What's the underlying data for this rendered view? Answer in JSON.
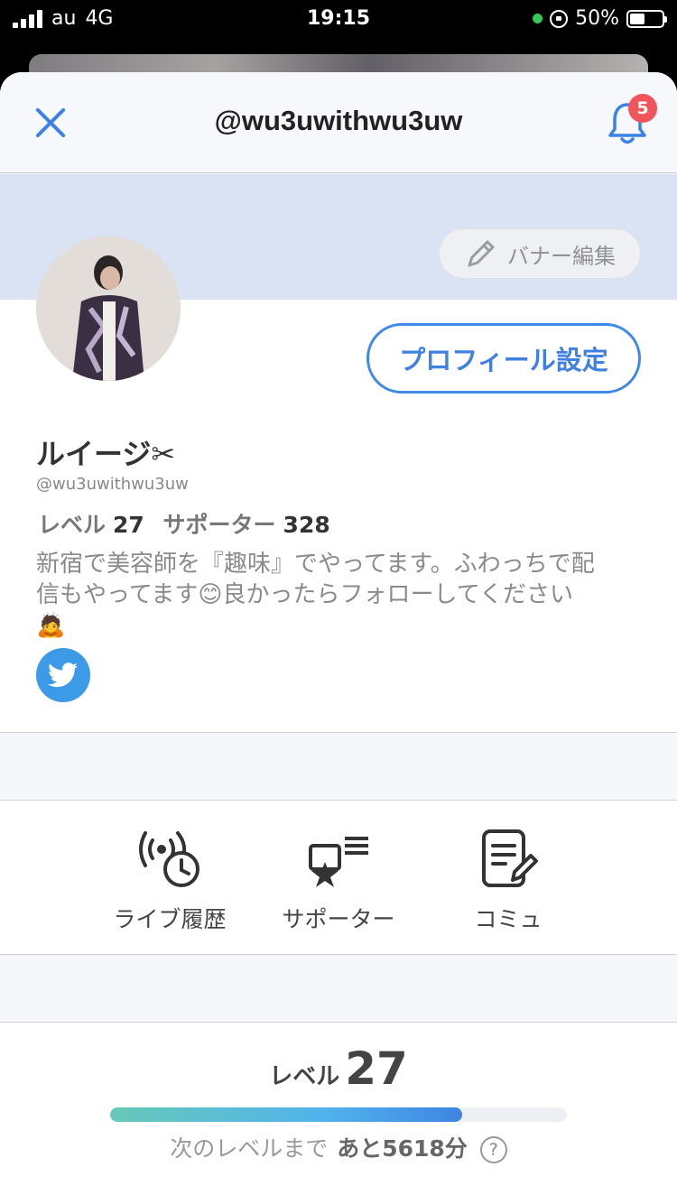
{
  "status_bar": {
    "carrier": "au",
    "network": "4G",
    "time": "19:15",
    "battery": "50%"
  },
  "header": {
    "title": "@wu3uwithwu3uw",
    "notification_count": "5"
  },
  "banner": {
    "edit_label": "バナー編集"
  },
  "profile": {
    "edit_button": "プロフィール設定",
    "name": "ルイージ✂︎",
    "handle": "@wu3uwithwu3uw",
    "level_label": "レベル",
    "level_value": "27",
    "supporter_label": "サポーター",
    "supporter_value": "328",
    "bio_line1": "新宿で美容師を『趣味』でやってます。ふわっちで配",
    "bio_line2": "信もやってます😊良かったらフォローしてください",
    "bio_line3": "🙇"
  },
  "menu": {
    "items": [
      {
        "label": "ライブ履歴",
        "icon": "live-history-icon"
      },
      {
        "label": "サポーター",
        "icon": "supporter-icon"
      },
      {
        "label": "コミュ",
        "icon": "community-icon"
      }
    ]
  },
  "level": {
    "label": "レベル",
    "value": "27",
    "progress": 0.77,
    "next_label": "次のレベルまで",
    "remaining": "あと5618分"
  },
  "colors": {
    "accent": "#3f80e0",
    "badge": "#f2545b",
    "banner": "#d9e3f3",
    "twitter": "#3d9ae6"
  }
}
